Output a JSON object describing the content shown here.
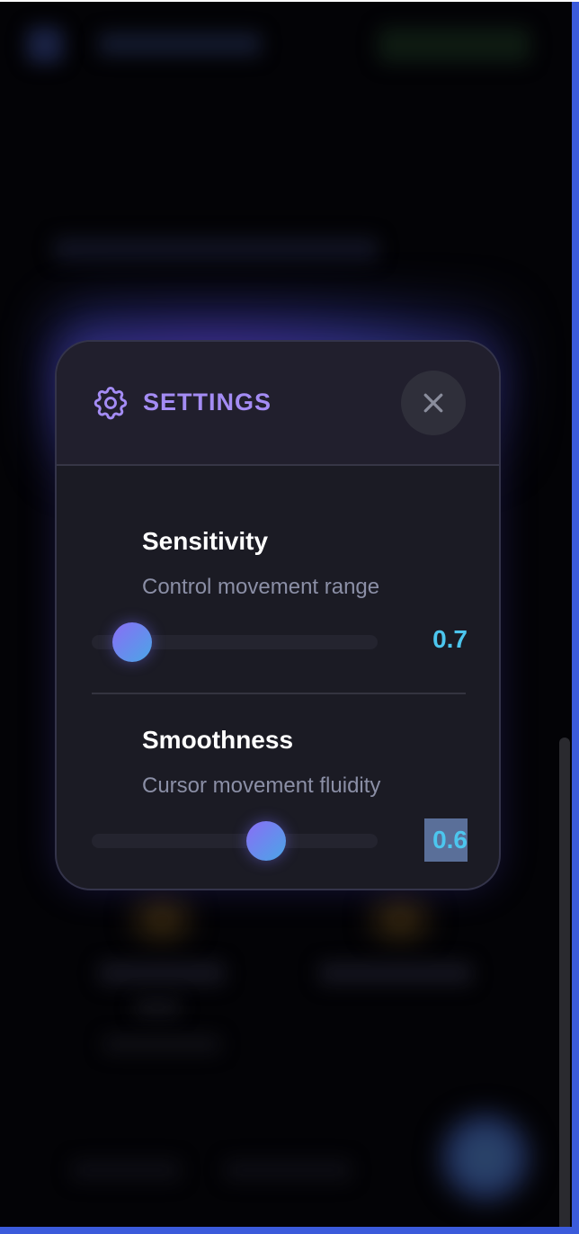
{
  "modal": {
    "title": "SETTINGS",
    "gear_icon": "gear-icon",
    "close_icon": "close-icon",
    "accent_color": "#a48cf4"
  },
  "settings": [
    {
      "title": "Sensitivity",
      "description": "Control movement range",
      "value": "0.7",
      "slider_fraction": 0.14
    },
    {
      "title": "Smoothness",
      "description": "Cursor movement fluidity",
      "value": "0.6",
      "slider_fraction": 0.61
    }
  ],
  "colors": {
    "value_color": "#4cc6ee",
    "thumb_gradient_start": "#8a6df6",
    "thumb_gradient_end": "#4aa6e6"
  }
}
